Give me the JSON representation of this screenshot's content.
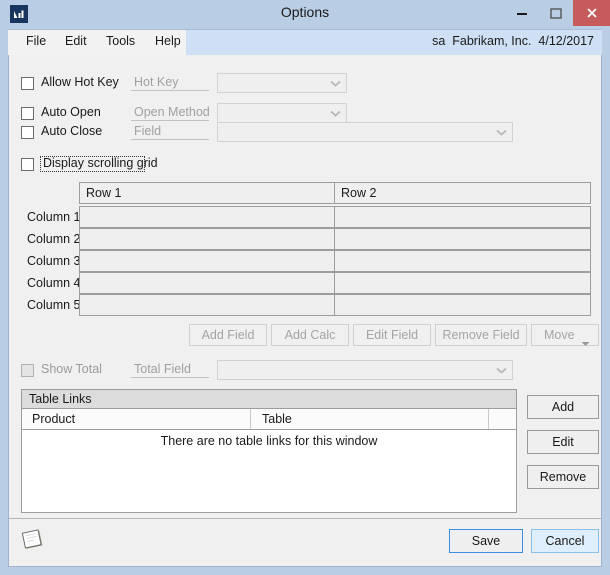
{
  "window": {
    "title": "Options",
    "icon": "dynamics-gp-chart-icon",
    "controls": {
      "minimize": "minimize-icon",
      "maximize": "maximize-icon",
      "close": "close-icon"
    },
    "accent_close": "#c75b5b",
    "frame_color": "#b9cde5",
    "client_bg": "#f0f0f0"
  },
  "menubar": {
    "items": [
      "File",
      "Edit",
      "Tools",
      "Help"
    ],
    "status": "sa  Fabrikam, Inc.  4/12/2017",
    "user": "sa",
    "company": "Fabrikam, Inc.",
    "date": "4/12/2017"
  },
  "options": {
    "allow_hot_key": {
      "label": "Allow Hot Key",
      "checked": false
    },
    "auto_open": {
      "label": "Auto Open",
      "checked": false
    },
    "auto_close": {
      "label": "Auto Close",
      "checked": false
    },
    "display_scrolling_grid": {
      "label": "Display scrolling grid",
      "checked": false,
      "focused": true
    },
    "show_total": {
      "label": "Show Total",
      "checked": false,
      "disabled": true
    }
  },
  "fields": {
    "hot_key": {
      "label": "Hot Key",
      "value": "",
      "disabled": true
    },
    "open_method": {
      "label": "Open Method",
      "value": "",
      "disabled": true
    },
    "field": {
      "label": "Field",
      "value": "",
      "disabled": true
    },
    "total_field": {
      "label": "Total Field",
      "value": "",
      "disabled": true
    }
  },
  "layout_grid": {
    "column_headers": [
      "Row 1",
      "Row 2"
    ],
    "row_labels": [
      "Column 1",
      "Column 2",
      "Column 3",
      "Column 4",
      "Column 5"
    ],
    "cells": [
      [
        "",
        ""
      ],
      [
        "",
        ""
      ],
      [
        "",
        ""
      ],
      [
        "",
        ""
      ],
      [
        "",
        ""
      ]
    ]
  },
  "field_buttons": {
    "add_field": "Add Field",
    "add_calc": "Add Calc",
    "edit_field": "Edit Field",
    "remove_field": "Remove Field",
    "move": "Move"
  },
  "table_links": {
    "title": "Table Links",
    "columns": [
      "Product",
      "Table"
    ],
    "empty_message": "There are no table links for this window",
    "rows": [],
    "buttons": {
      "add": "Add",
      "edit": "Edit",
      "remove": "Remove"
    }
  },
  "footer": {
    "note_icon": "note-icon",
    "save": "Save",
    "cancel": "Cancel"
  }
}
